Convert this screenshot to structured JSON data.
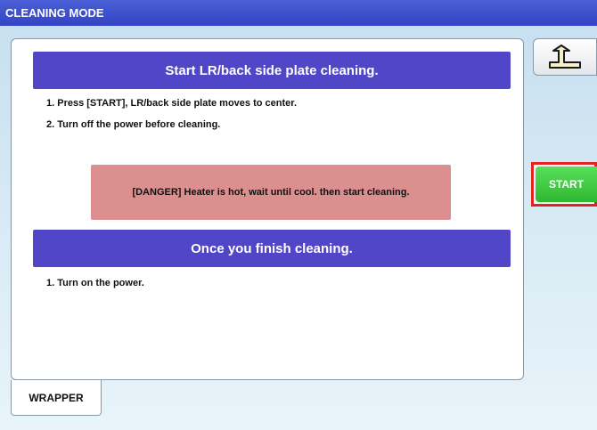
{
  "window": {
    "title": "CLEANING MODE"
  },
  "section_start": {
    "header": "Start LR/back side plate cleaning.",
    "steps": [
      "1. Press [START], LR/back side plate moves to center.",
      "2. Turn off the power before cleaning."
    ],
    "warning": "[DANGER] Heater is hot, wait until cool. then start cleaning."
  },
  "section_finish": {
    "header": "Once you finish cleaning.",
    "steps": [
      "1. Turn on the power."
    ]
  },
  "side_buttons": {
    "back_icon": "return-arrow-icon",
    "start_label": "START"
  },
  "tabs": [
    {
      "label": "WRAPPER"
    }
  ],
  "colors": {
    "title_bar": "#3a4fd0",
    "section_header": "#5145c8",
    "warning_bg": "#db8f8f",
    "start_button": "#3cc83e",
    "highlight_border": "#e52222"
  }
}
